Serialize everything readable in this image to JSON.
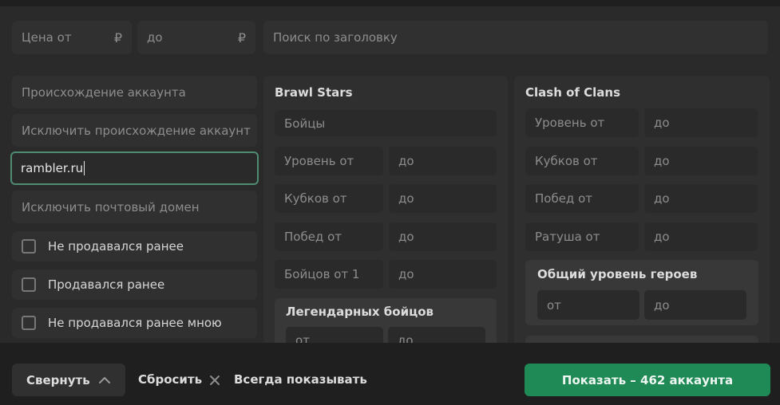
{
  "filters": {
    "price_from_placeholder": "Цена от",
    "price_to_placeholder": "до",
    "currency": "₽",
    "search_placeholder": "Поиск по заголовку",
    "origin_placeholder": "Происхождение аккаунта",
    "exclude_origin_placeholder": "Исключить происхождение аккаунт",
    "email_domain_value": "rambler.ru",
    "exclude_email_domain_placeholder": "Исключить почтовый домен",
    "checkboxes": [
      {
        "label": "Не продавался ранее",
        "checked": false
      },
      {
        "label": "Продавался ранее",
        "checked": false
      },
      {
        "label": "Не продавался ранее мною",
        "checked": false
      }
    ]
  },
  "brawl_stars": {
    "title": "Brawl Stars",
    "fighters_placeholder": "Бойцы",
    "rows": [
      {
        "from": "Уровень от",
        "to": "до"
      },
      {
        "from": "Кубков от",
        "to": "до"
      },
      {
        "from": "Побед от",
        "to": "до"
      },
      {
        "from": "Бойцов от 1",
        "to": "до"
      }
    ],
    "legendary": {
      "title": "Легендарных бойцов",
      "from": "от",
      "to": "до"
    }
  },
  "clash_of_clans": {
    "title": "Clash of Clans",
    "rows": [
      {
        "from": "Уровень от",
        "to": "до"
      },
      {
        "from": "Кубков от",
        "to": "до"
      },
      {
        "from": "Побед от",
        "to": "до"
      },
      {
        "from": "Ратуша от",
        "to": "до"
      }
    ],
    "heroes": {
      "title": "Общий уровень героев",
      "from": "от",
      "to": "до"
    }
  },
  "footer": {
    "collapse_label": "Свернуть",
    "reset_label": "Сбросить",
    "always_show_label": "Всегда показывать",
    "show_button_label": "Показать – 462 аккаунта"
  },
  "colors": {
    "accent_green": "#1f8a55",
    "focus_border": "#4f8c73",
    "background": "#2a2a2a"
  },
  "icons": {
    "collapse": "chevron-up-icon",
    "reset": "close-icon"
  }
}
